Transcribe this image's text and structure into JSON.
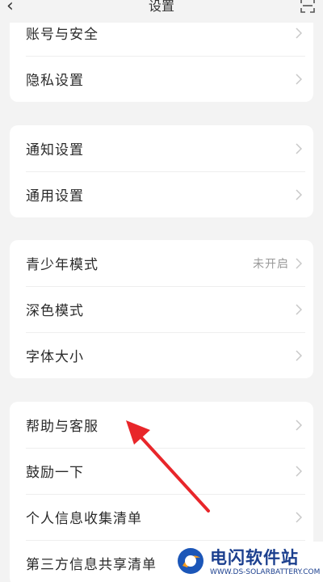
{
  "header": {
    "title": "设置"
  },
  "groups": [
    {
      "items": [
        {
          "label": "账号与安全"
        },
        {
          "label": "隐私设置"
        }
      ]
    },
    {
      "items": [
        {
          "label": "通知设置"
        },
        {
          "label": "通用设置"
        }
      ]
    },
    {
      "items": [
        {
          "label": "青少年模式",
          "value": "未开启"
        },
        {
          "label": "深色模式"
        },
        {
          "label": "字体大小"
        }
      ]
    },
    {
      "items": [
        {
          "label": "帮助与客服"
        },
        {
          "label": "鼓励一下"
        },
        {
          "label": "个人信息收集清单"
        },
        {
          "label": "第三方信息共享清单"
        }
      ]
    }
  ],
  "annotation": {
    "arrow_color": "#e8262a"
  },
  "watermark": {
    "name": "电闪软件站",
    "url": "WWW.DS-SOLARBATTERY.COM"
  }
}
